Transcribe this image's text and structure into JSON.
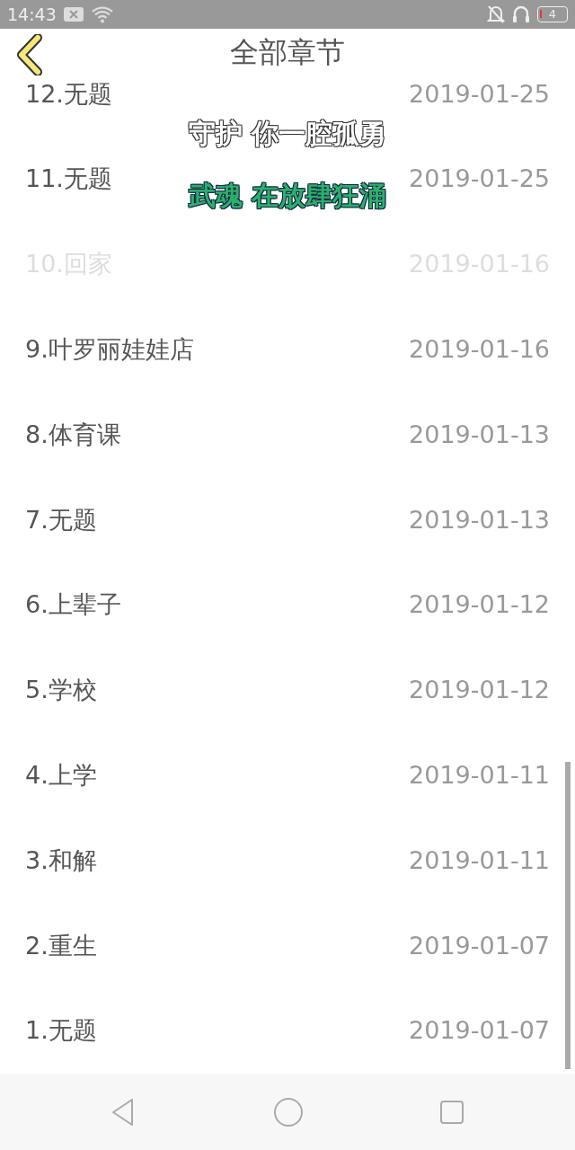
{
  "status_bar": {
    "time": "14:43",
    "battery": "4"
  },
  "header": {
    "title": "全部章节"
  },
  "chapters": [
    {
      "title": "12.无题",
      "date": "2019-01-25",
      "faded": false
    },
    {
      "title": "11.无题",
      "date": "2019-01-25",
      "faded": false
    },
    {
      "title": "10.回家",
      "date": "2019-01-16",
      "faded": true
    },
    {
      "title": "9.叶罗丽娃娃店",
      "date": "2019-01-16",
      "faded": false
    },
    {
      "title": "8.体育课",
      "date": "2019-01-13",
      "faded": false
    },
    {
      "title": "7.无题",
      "date": "2019-01-13",
      "faded": false
    },
    {
      "title": "6.上辈子",
      "date": "2019-01-12",
      "faded": false
    },
    {
      "title": "5.学校",
      "date": "2019-01-12",
      "faded": false
    },
    {
      "title": "4.上学",
      "date": "2019-01-11",
      "faded": false
    },
    {
      "title": "3.和解",
      "date": "2019-01-11",
      "faded": false
    },
    {
      "title": "2.重生",
      "date": "2019-01-07",
      "faded": false
    },
    {
      "title": "1.无题",
      "date": "2019-01-07",
      "faded": false
    }
  ],
  "lyrics": [
    {
      "text": "守护 你一腔孤勇",
      "kind": "outline"
    },
    {
      "text": "武魂 在放肆狂涌",
      "kind": "green"
    }
  ]
}
